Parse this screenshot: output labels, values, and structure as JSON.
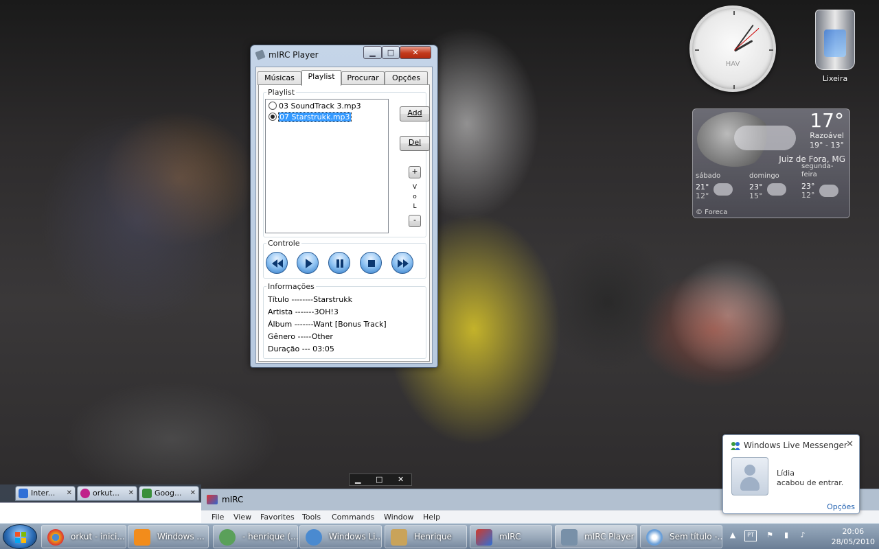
{
  "desktop": {
    "recycle_bin_label": "Lixeira"
  },
  "clock_gadget": {
    "label": "HAV"
  },
  "weather_gadget": {
    "temperature": "17°",
    "condition": "Razoável",
    "range": "19° - 13°",
    "city": "Juiz de Fora, MG",
    "days": [
      {
        "name": "sábado",
        "high": "21°",
        "low": "12°"
      },
      {
        "name": "domingo",
        "high": "23°",
        "low": "15°"
      },
      {
        "name": "segunda-feira",
        "high": "23°",
        "low": "12°"
      }
    ],
    "credit": "© Foreca"
  },
  "player": {
    "title": "mIRC Player",
    "tabs": [
      "Músicas",
      "Playlist",
      "Procurar",
      "Opções"
    ],
    "active_tab": "Playlist",
    "playlist": {
      "group_title": "Playlist",
      "items": [
        {
          "label": "03 SoundTrack 3.mp3",
          "selected": false
        },
        {
          "label": "07 Starstrukk.mp3",
          "selected": true
        }
      ],
      "add_label": "Add",
      "del_label": "Del",
      "vol_up": "+",
      "vol_down": "-",
      "vol_letters": [
        "V",
        "o",
        "L"
      ]
    },
    "controls": {
      "group_title": "Controle",
      "buttons": [
        "rewind",
        "play",
        "pause",
        "stop",
        "fast-forward"
      ]
    },
    "info": {
      "group_title": "Informações",
      "rows": [
        {
          "key": "Título",
          "value": "--------Starstrukk"
        },
        {
          "key": "Artista",
          "value": "-------3OH!3"
        },
        {
          "key": "Álbum",
          "value": "-------Want [Bonus Track]"
        },
        {
          "key": "Gênero",
          "value": "-----Other"
        },
        {
          "key": "Duração",
          "value": "--- 03:05"
        }
      ]
    }
  },
  "mirc_window": {
    "title": "mIRC",
    "menu": [
      "File",
      "View",
      "Favorites",
      "Tools",
      "Commands",
      "Window",
      "Help"
    ]
  },
  "browser": {
    "tabs": [
      {
        "label": "Inter...",
        "color": "#2f6fd6"
      },
      {
        "label": "orkut...",
        "color": "#c0218a"
      },
      {
        "label": "Goog...",
        "color": "#3a8f3a"
      }
    ],
    "caption": {
      "min": "▁",
      "max": "□",
      "close": "✕"
    }
  },
  "messenger_toast": {
    "title": "Windows Live Messenger",
    "name": "Lídia",
    "message": "acabou de entrar.",
    "options": "Opções",
    "close": "✕"
  },
  "taskbar": {
    "items": [
      {
        "label": "orkut - inici...",
        "color": "#e8a317"
      },
      {
        "label": "Windows ...",
        "color": "#f28c1b"
      },
      {
        "label": "- henrique (...",
        "color": "#5aa05a"
      },
      {
        "label": "Windows Li...",
        "color": "#4a8ad0"
      },
      {
        "label": "Henrique",
        "color": "#c9a35a"
      },
      {
        "label": "mIRC",
        "color": "#d03a2a"
      },
      {
        "label": "mIRC Player",
        "color": "#7890a8"
      },
      {
        "label": "Sem título -...",
        "color": "#6a9fd8"
      }
    ],
    "active_item": "mIRC Player",
    "tray": {
      "language": "PT",
      "time": "20:06",
      "date": "28/05/2010"
    }
  }
}
